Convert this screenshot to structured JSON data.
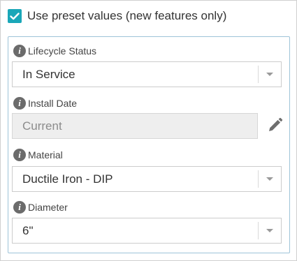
{
  "preset": {
    "checked": true,
    "label": "Use preset values (new features only)",
    "accent_color": "#1aa7b8"
  },
  "fields": [
    {
      "label": "Lifecycle Status",
      "value": "In Service",
      "icon": "info-icon",
      "control": "dropdown"
    },
    {
      "label": "Install Date",
      "value": "Current",
      "icon": "info-icon",
      "control": "readonly",
      "action_icon": "pencil-icon"
    },
    {
      "label": "Material",
      "value": "Ductile Iron - DIP",
      "icon": "info-icon",
      "control": "dropdown"
    },
    {
      "label": "Diameter",
      "value": "6\"",
      "icon": "info-icon",
      "control": "dropdown"
    }
  ],
  "icons": {
    "info": "i"
  }
}
